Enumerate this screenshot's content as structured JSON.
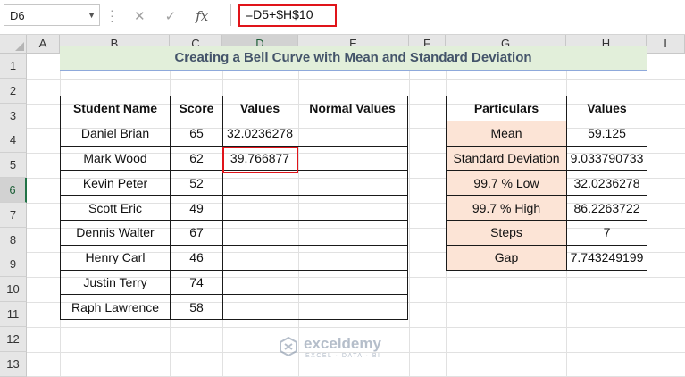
{
  "name_box": {
    "value": "D6"
  },
  "formula_bar": {
    "formula": "=D5+$H$10",
    "fx_label": "fx"
  },
  "columns": [
    "A",
    "B",
    "C",
    "D",
    "E",
    "F",
    "G",
    "H",
    "I"
  ],
  "rows": [
    "1",
    "2",
    "3",
    "4",
    "5",
    "6",
    "7",
    "8",
    "9",
    "10",
    "11",
    "12",
    "13"
  ],
  "selected_cell": "D6",
  "title": "Creating a Bell Curve with Mean and Standard Deviation",
  "students_table": {
    "headers": [
      "Student Name",
      "Score",
      "Values",
      "Normal Values"
    ],
    "rows": [
      [
        "Daniel Brian",
        "65",
        "32.0236278",
        ""
      ],
      [
        "Mark Wood",
        "62",
        "39.766877",
        ""
      ],
      [
        "Kevin Peter",
        "52",
        "",
        ""
      ],
      [
        "Scott Eric",
        "49",
        "",
        ""
      ],
      [
        "Dennis Walter",
        "67",
        "",
        ""
      ],
      [
        "Henry Carl",
        "46",
        "",
        ""
      ],
      [
        "Justin Terry",
        "74",
        "",
        ""
      ],
      [
        "Raph Lawrence",
        "58",
        "",
        ""
      ]
    ]
  },
  "particulars_table": {
    "headers": [
      "Particulars",
      "Values"
    ],
    "rows": [
      [
        "Mean",
        "59.125"
      ],
      [
        "Standard Deviation",
        "9.033790733"
      ],
      [
        "99.7 % Low",
        "32.0236278"
      ],
      [
        "99.7 % High",
        "86.2263722"
      ],
      [
        "Steps",
        "7"
      ],
      [
        "Gap",
        "7.743249199"
      ]
    ]
  },
  "watermark": {
    "name": "exceldemy",
    "tagline": "EXCEL · DATA · BI"
  },
  "colors": {
    "accent_green": "#217346",
    "highlight_red": "#e0141a",
    "title_fill": "#e2efda",
    "label_fill": "#fce4d6"
  }
}
